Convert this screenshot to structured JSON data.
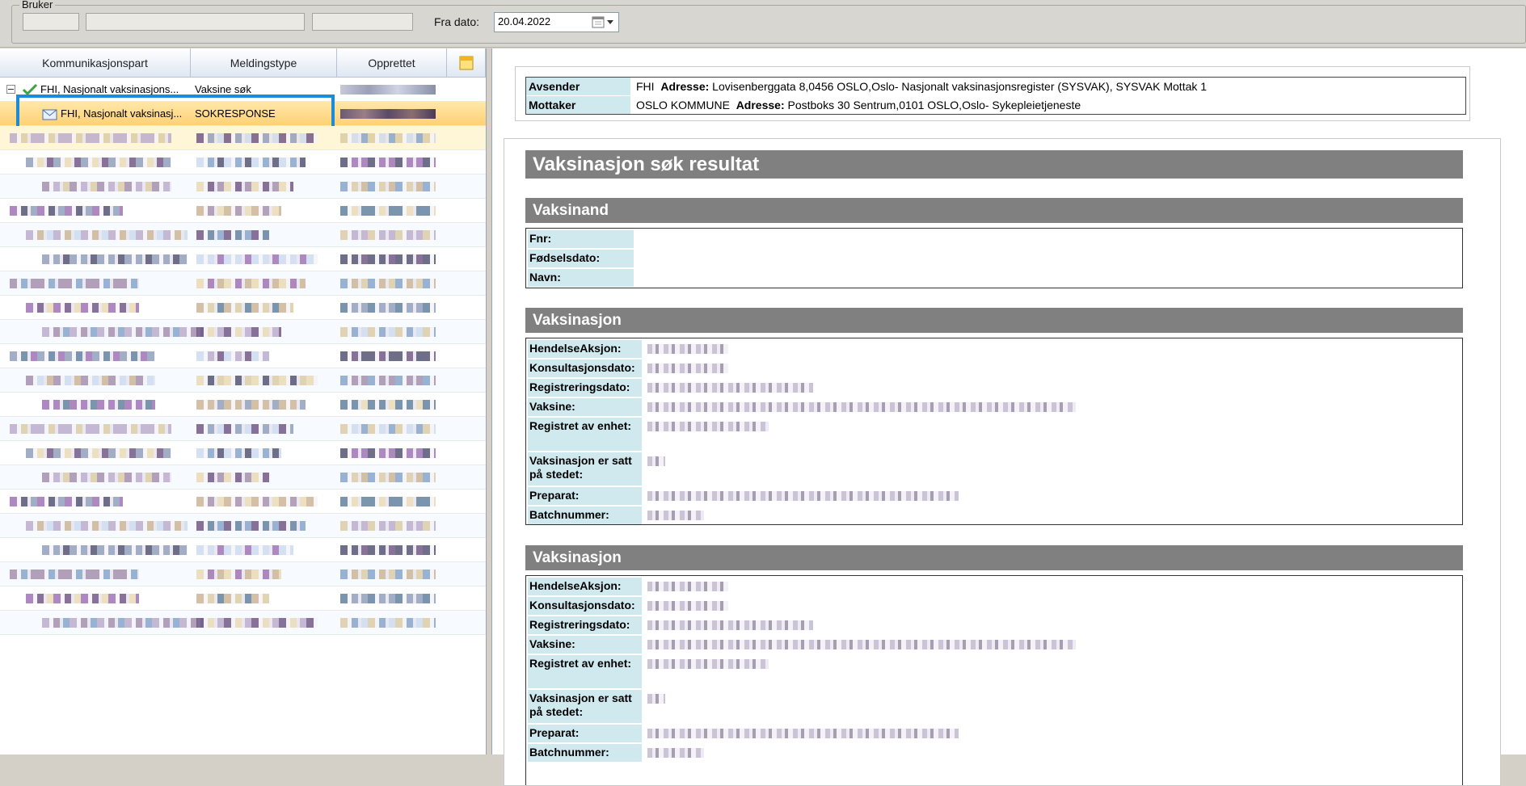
{
  "filter": {
    "group_title": "Bruker",
    "fra_dato_label": "Fra dato:",
    "fra_dato_value": "20.04.2022"
  },
  "list": {
    "columns": [
      "Kommunikasjonspart",
      "Meldingstype",
      "Opprettet"
    ],
    "parent_row": {
      "part": "FHI, Nasjonalt vaksinasjons...",
      "type": "Vaksine søk"
    },
    "selected_row": {
      "part": "FHI, Nasjonalt vaksinasj...",
      "type": "SOKRESPONSE"
    }
  },
  "header": {
    "avsender_label": "Avsender",
    "avsender_name": "FHI",
    "avsender_adr_label": "Adresse:",
    "avsender_adr": "Lovisenberggata 8,0456 OSLO,Oslo- Nasjonalt vaksinasjonsregister (SYSVAK), SYSVAK Mottak 1",
    "mottaker_label": "Mottaker",
    "mottaker_name": "OSLO KOMMUNE",
    "mottaker_adr_label": "Adresse:",
    "mottaker_adr": "Postboks 30 Sentrum,0101 OSLO,Oslo- Sykepleietjeneste"
  },
  "document": {
    "title": "Vaksinasjon søk resultat",
    "vaksinand": {
      "heading": "Vaksinand",
      "fnr_label": "Fnr:",
      "fodselsdato_label": "Fødselsdato:",
      "navn_label": "Navn:"
    },
    "vaksinasjon1": {
      "heading": "Vaksinasjon",
      "labels": {
        "hendelse": "HendelseAksjon:",
        "konsultasjon": "Konsultasjonsdato:",
        "registrering": "Registreringsdato:",
        "vaksine": "Vaksine:",
        "registrert_av": "Registret av enhet:",
        "satt": "Vaksinasjon er satt på stedet:",
        "preparat": "Preparat:",
        "batch": "Batchnummer:"
      }
    },
    "vaksinasjon2": {
      "heading": "Vaksinasjon",
      "labels": {
        "hendelse": "HendelseAksjon:",
        "konsultasjon": "Konsultasjonsdato:",
        "registrering": "Registreringsdato:",
        "vaksine": "Vaksine:",
        "registrert_av": "Registret av enhet:",
        "satt": "Vaksinasjon er satt på stedet:",
        "preparat": "Preparat:",
        "batch": "Batchnummer:"
      }
    }
  },
  "colors": {
    "selection": "#1d8bd6",
    "section_gray": "#808080",
    "label_bg": "#cfe9ef"
  },
  "icons": [
    "check-icon",
    "envelope-icon",
    "calendar-icon",
    "dropdown-arrow-icon",
    "collapse-minus-icon",
    "column-chooser-icon"
  ]
}
